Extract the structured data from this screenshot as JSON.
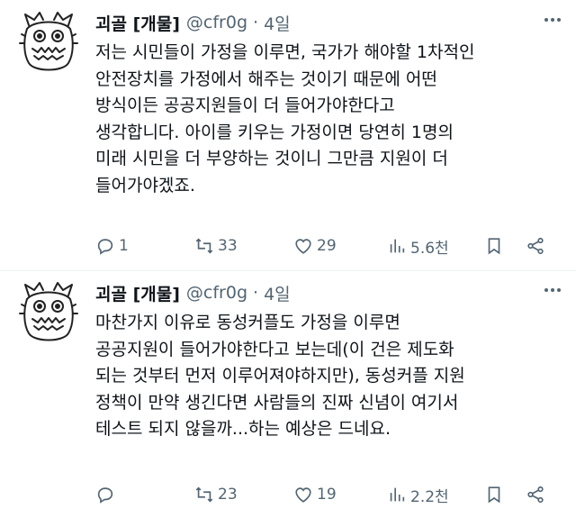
{
  "tweets": [
    {
      "display_name": "괴골 [개물]",
      "handle": "@cfr0g",
      "separator": "·",
      "time": "4일",
      "lines": [
        "저는 시민들이 가정을 이루면, 국가가  해야할 1차적인",
        "안전장치를 가정에서 해주는 것이기 때문에 어떤",
        "방식이든 공공지원들이 더 들어가야한다고",
        "생각합니다. 아이를 키우는 가정이면 당연히 1명의",
        "미래 시민을 더 부양하는 것이니 그만큼 지원이 더",
        "들어가야겠죠."
      ],
      "replies": "1",
      "retweets": "33",
      "likes": "29",
      "views": "5.6천"
    },
    {
      "display_name": "괴골 [개물]",
      "handle": "@cfr0g",
      "separator": "·",
      "time": "4일",
      "lines": [
        "마찬가지 이유로 동성커플도 가정을 이루면",
        "공공지원이 들어가야한다고 보는데(이 건은 제도화",
        "되는 것부터 먼저 이루어져야하지만), 동성커플 지원",
        "정책이 만약 생긴다면 사람들의 진짜 신념이 여기서",
        "테스트 되지 않을까...하는 예상은 드네요."
      ],
      "replies": "",
      "retweets": "23",
      "likes": "19",
      "views": "2.2천"
    }
  ],
  "icons": {
    "avatar": "frog-doodle-avatar",
    "more": "more-dots-icon",
    "reply": "reply-icon",
    "retweet": "retweet-icon",
    "like": "heart-icon",
    "views": "views-bar-icon",
    "bookmark": "bookmark-icon",
    "share": "share-icon"
  },
  "colors": {
    "text": "#0f1419",
    "secondary": "#536471",
    "divider": "#eff3f4"
  }
}
